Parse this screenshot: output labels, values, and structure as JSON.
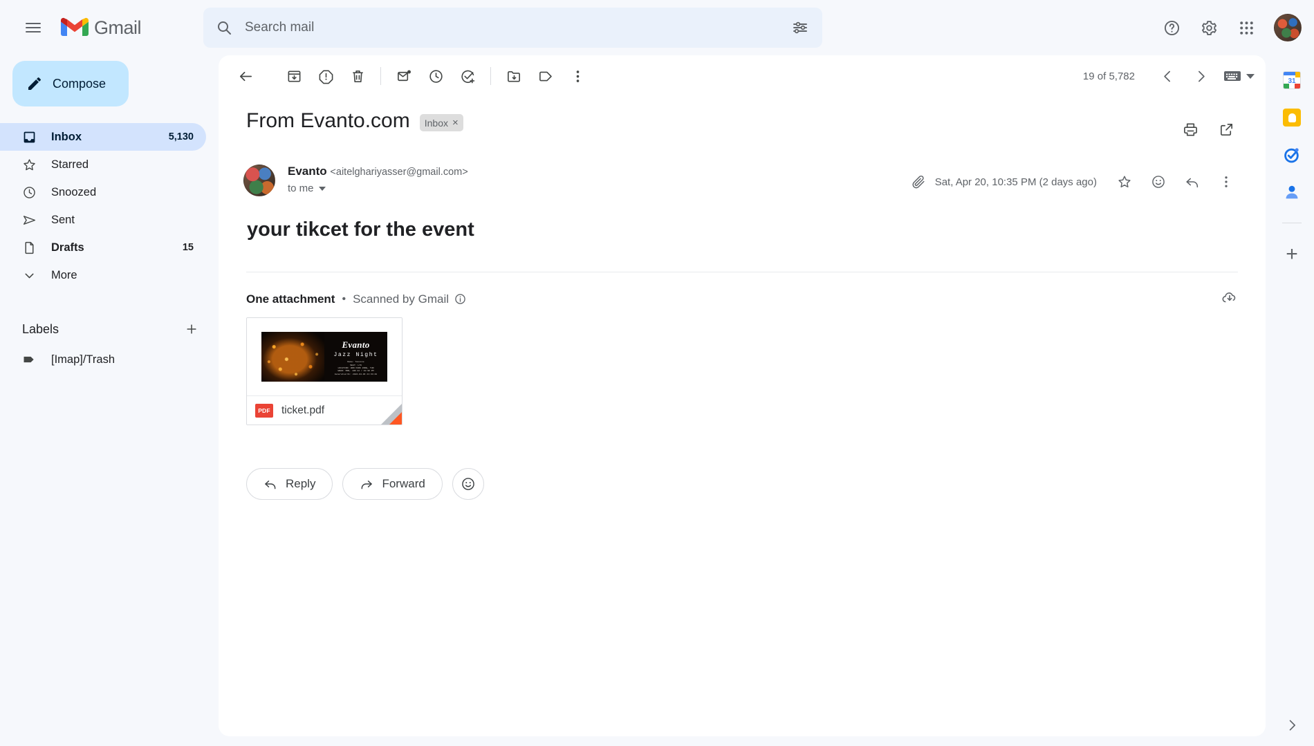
{
  "app": {
    "brand": "Gmail",
    "menu_icon": "hamburger-icon"
  },
  "search": {
    "placeholder": "Search mail",
    "value": "",
    "search_icon": "search-icon",
    "options_icon": "search-options-icon"
  },
  "topbar": {
    "help_icon": "help-icon",
    "settings_icon": "gear-icon",
    "apps_icon": "apps-grid-icon",
    "avatar": "account-avatar"
  },
  "sidebar": {
    "compose_label": "Compose",
    "items": [
      {
        "label": "Inbox",
        "count": "5,130",
        "icon": "inbox-icon",
        "active": true
      },
      {
        "label": "Starred",
        "count": "",
        "icon": "star-icon",
        "active": false
      },
      {
        "label": "Snoozed",
        "count": "",
        "icon": "clock-icon",
        "active": false
      },
      {
        "label": "Sent",
        "count": "",
        "icon": "send-icon",
        "active": false
      },
      {
        "label": "Drafts",
        "count": "15",
        "icon": "draft-icon",
        "active": false
      },
      {
        "label": "More",
        "count": "",
        "icon": "chevron-down-icon",
        "active": false
      }
    ],
    "labels_heading": "Labels",
    "add_label_icon": "plus-icon",
    "labels": [
      {
        "label": "[Imap]/Trash",
        "icon": "label-tag-icon"
      }
    ]
  },
  "toolbar": {
    "back_label": "Back to Inbox",
    "icons": [
      "back-arrow-icon",
      "archive-icon",
      "report-spam-icon",
      "delete-icon",
      "mark-unread-icon",
      "snooze-icon",
      "add-to-tasks-icon",
      "move-to-icon",
      "labels-icon",
      "more-options-icon"
    ],
    "pagination": "19 of 5,782",
    "prev_icon": "previous-icon",
    "next_icon": "next-icon",
    "keyboard_icon": "keyboard-icon",
    "keyboard_caret": "chevron-down-icon"
  },
  "thread": {
    "subject": "From Evanto.com",
    "chip_label": "Inbox",
    "chip_remove": "×",
    "print_icon": "print-icon",
    "popout_icon": "open-in-new-window-icon"
  },
  "message": {
    "sender_name": "Evanto",
    "sender_email": "<aitelghariyasser@gmail.com>",
    "recipient": "to me",
    "attachment_icon": "paperclip-icon",
    "date": "Sat, Apr 20, 10:35 PM (2 days ago)",
    "star_icon": "star-icon",
    "react_icon": "emoji-react-icon",
    "reply_icon": "reply-icon",
    "more_icon": "more-options-icon",
    "body_heading": "your tikcet for the event"
  },
  "attachments": {
    "summary": "One attachment",
    "separator": "•",
    "scanned": "Scanned by Gmail",
    "info_icon": "info-icon",
    "download_all_icon": "save-to-drive-icon",
    "files": [
      {
        "name": "ticket.pdf",
        "type_badge": "PDF",
        "preview": {
          "brand": "Evanto",
          "title": "Jazz Night",
          "lines": [
            "Name: Yassine",
            "SEAT: L79",
            "LOCATION: BRN PARK ZONE, TUN",
            "WHEN: MON, JUN 22 / 10:30 PM",
            "Generated On: 2024-04-03 21:34:48"
          ]
        }
      }
    ]
  },
  "actions": {
    "reply_label": "Reply",
    "reply_icon": "reply-arrow-icon",
    "forward_label": "Forward",
    "forward_icon": "forward-arrow-icon",
    "emoji_icon": "emoji-smiley-icon"
  },
  "right_rail": {
    "items": [
      {
        "name": "google-calendar-icon",
        "label": "31"
      },
      {
        "name": "google-keep-icon",
        "label": ""
      },
      {
        "name": "google-tasks-icon",
        "label": ""
      },
      {
        "name": "google-contacts-icon",
        "label": ""
      }
    ],
    "add_icon": "plus-icon",
    "expand_icon": "chevron-right-icon"
  },
  "colors": {
    "accent": "#c2e7ff",
    "active_nav": "#d3e3fd",
    "brand_red": "#ea4335",
    "brand_blue": "#4285f4",
    "brand_yellow": "#fbbc04",
    "brand_green": "#34a853",
    "page_bg": "#f6f8fc"
  }
}
